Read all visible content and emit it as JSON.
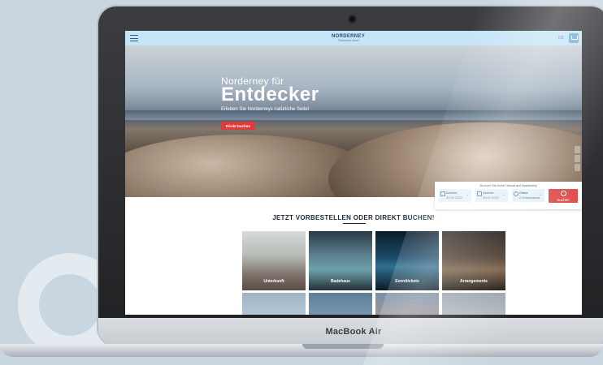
{
  "device": {
    "brand_label": "MacBook Air"
  },
  "site": {
    "logo_main": "NORDERNEY",
    "logo_sub": "Thalasso Insel",
    "top_right_label": "DE"
  },
  "hero": {
    "subtitle": "Norderney für",
    "title": "Entdecker",
    "tagline": "Erleben Sie Norderneys natürliche Seite!",
    "cta_label": "Direkt buchen"
  },
  "booking": {
    "title": "Buchen Sie Ihren Urlaub auf Norderney",
    "arrival_label": "Anreise",
    "arrival_value": "20.01.2022",
    "departure_label": "Abreise",
    "departure_value": "20.01.2022",
    "guests_label": "Gäste",
    "guests_value": "2 Erwachsene",
    "search_label": "Suchen"
  },
  "section": {
    "title": "JETZT VORBESTELLEN ODER DIREKT BUCHEN!"
  },
  "tiles": [
    {
      "label": "Unterkunft"
    },
    {
      "label": "Badehaus"
    },
    {
      "label": "Eventtickets"
    },
    {
      "label": "Arrangements"
    }
  ],
  "colors": {
    "topbar": "#c5e4f5",
    "cta_red": "#e03a3a",
    "search_red": "#e05050",
    "heading": "#1c2a36"
  },
  "icons": {
    "menu": "hamburger-icon",
    "cart": "cart-icon",
    "calendar": "calendar-icon",
    "guests": "person-icon",
    "search": "search-icon"
  }
}
